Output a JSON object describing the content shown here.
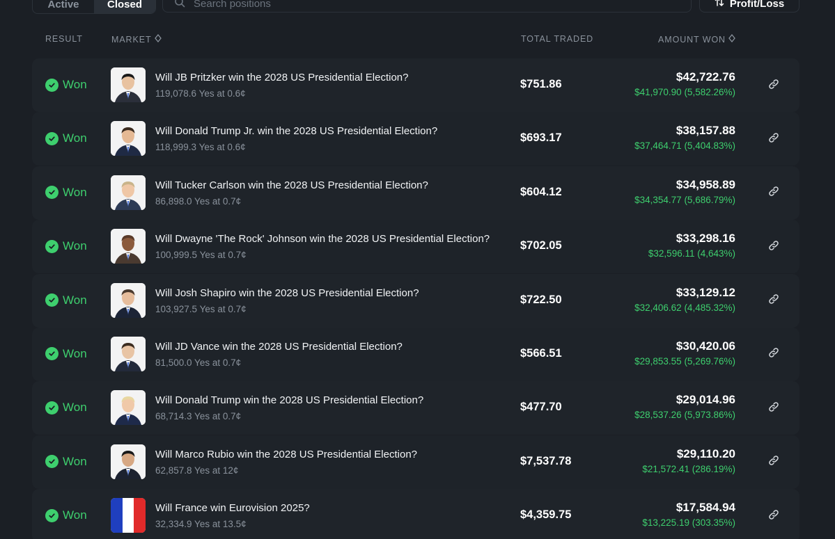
{
  "tabs": {
    "active_label": "Active",
    "closed_label": "Closed"
  },
  "search": {
    "placeholder": "Search positions"
  },
  "sort": {
    "label": "Profit/Loss"
  },
  "columns": {
    "result": "RESULT",
    "market": "MARKET",
    "total_traded": "TOTAL TRADED",
    "amount_won": "AMOUNT WON"
  },
  "colors": {
    "background": "#1b1f25",
    "row": "#1f242a",
    "accent_green": "#3ecf6e",
    "muted": "#8a929c"
  },
  "rows": [
    {
      "result": "Won",
      "title": "Will JB Pritzker win the 2028 US Presidential Election?",
      "sub": "119,078.6 Yes at 0.6¢",
      "traded": "$751.86",
      "amount": "$42,722.76",
      "profit": "$41,970.90 (5,582.26%)",
      "thumb": "portrait-icon"
    },
    {
      "result": "Won",
      "title": "Will Donald Trump Jr. win the 2028 US Presidential Election?",
      "sub": "118,999.3 Yes at 0.6¢",
      "traded": "$693.17",
      "amount": "$38,157.88",
      "profit": "$37,464.71 (5,404.83%)",
      "thumb": "portrait-icon"
    },
    {
      "result": "Won",
      "title": "Will Tucker Carlson win the 2028 US Presidential Election?",
      "sub": "86,898.0 Yes at 0.7¢",
      "traded": "$604.12",
      "amount": "$34,958.89",
      "profit": "$34,354.77 (5,686.79%)",
      "thumb": "portrait-icon"
    },
    {
      "result": "Won",
      "title": "Will Dwayne 'The Rock' Johnson win the 2028 US Presidential Election?",
      "sub": "100,999.5 Yes at 0.7¢",
      "traded": "$702.05",
      "amount": "$33,298.16",
      "profit": "$32,596.11 (4,643%)",
      "thumb": "portrait-icon"
    },
    {
      "result": "Won",
      "title": "Will Josh Shapiro win the 2028 US Presidential Election?",
      "sub": "103,927.5 Yes at 0.7¢",
      "traded": "$722.50",
      "amount": "$33,129.12",
      "profit": "$32,406.62 (4,485.32%)",
      "thumb": "portrait-icon"
    },
    {
      "result": "Won",
      "title": "Will JD Vance win the 2028 US Presidential Election?",
      "sub": "81,500.0 Yes at 0.7¢",
      "traded": "$566.51",
      "amount": "$30,420.06",
      "profit": "$29,853.55 (5,269.76%)",
      "thumb": "portrait-icon"
    },
    {
      "result": "Won",
      "title": "Will Donald Trump win the 2028 US Presidential Election?",
      "sub": "68,714.3 Yes at 0.7¢",
      "traded": "$477.70",
      "amount": "$29,014.96",
      "profit": "$28,537.26 (5,973.86%)",
      "thumb": "portrait-icon"
    },
    {
      "result": "Won",
      "title": "Will Marco Rubio win the 2028 US Presidential Election?",
      "sub": "62,857.8 Yes at 12¢",
      "traded": "$7,537.78",
      "amount": "$29,110.20",
      "profit": "$21,572.41 (286.19%)",
      "thumb": "portrait-icon"
    },
    {
      "result": "Won",
      "title": "Will France win Eurovision 2025?",
      "sub": "32,334.9 Yes at 13.5¢",
      "traded": "$4,359.75",
      "amount": "$17,584.94",
      "profit": "$13,225.19 (303.35%)",
      "thumb": "france-flag-icon"
    }
  ]
}
